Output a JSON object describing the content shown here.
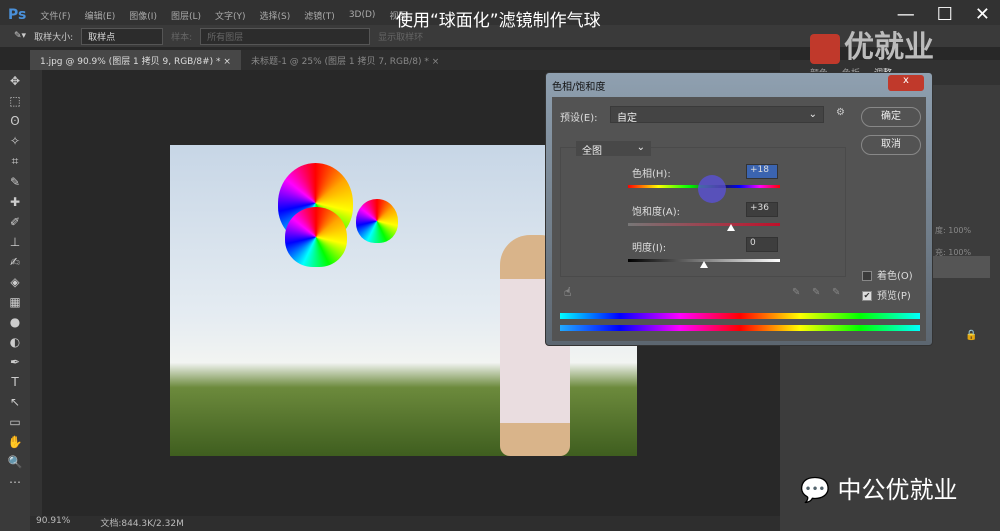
{
  "menubar": {
    "logo": "Ps",
    "items": [
      "文件(F)",
      "编辑(E)",
      "图像(I)",
      "图层(L)",
      "文字(Y)",
      "选择(S)",
      "滤镜(T)",
      "3D(D)",
      "视图"
    ]
  },
  "video_title": "使用“球面化”滤镜制作气球",
  "window_controls": {
    "minimize": "—",
    "maximize": "☐",
    "close": "✕"
  },
  "options": {
    "sample_size_label": "取样大小:",
    "sample_size": "取样点",
    "sample_label": "样本:",
    "sample": "所有图层",
    "show_ring": "显示取样环"
  },
  "tabs": [
    {
      "label": "1.jpg @ 90.9% (图层 1 拷贝 9, RGB/8#) *",
      "close": "×"
    },
    {
      "label": "未标题-1 @ 25% (图层 1 拷贝 7, RGB/8) *",
      "close": "×"
    }
  ],
  "tools": [
    "✥",
    "⬚",
    "ʘ",
    "✧",
    "⌗",
    "✎",
    "✚",
    "✐",
    "⊥",
    "✍",
    "◈",
    "▦",
    "●",
    "◐",
    "✒",
    "T",
    "↖",
    "▭",
    "✋",
    "🔍",
    "⋯"
  ],
  "right_panel": {
    "tabs": [
      "颜色",
      "色板",
      "调整"
    ],
    "opacity_label": "度:",
    "opacity": "100%",
    "fill_label": "充:",
    "fill": "100%"
  },
  "watermark": {
    "logo_text": "优就业",
    "bottom_text": "中公优就业"
  },
  "status": {
    "zoom": "90.91%",
    "doc": "文档:844.3K/2.32M"
  },
  "dialog": {
    "title": "色相/饱和度",
    "close": "x",
    "preset_label": "预设(E):",
    "preset": "自定",
    "ok": "确定",
    "cancel": "取消",
    "channel": "全图",
    "hue_label": "色相(H):",
    "hue": "+18",
    "hue_pct": 0.55,
    "sat_label": "饱和度(A):",
    "sat": "+36",
    "sat_pct": 0.68,
    "light_label": "明度(I):",
    "light": "0",
    "light_pct": 0.5,
    "colorize": "着色(O)",
    "preview": "预览(P)",
    "preview_checked": "✔"
  }
}
